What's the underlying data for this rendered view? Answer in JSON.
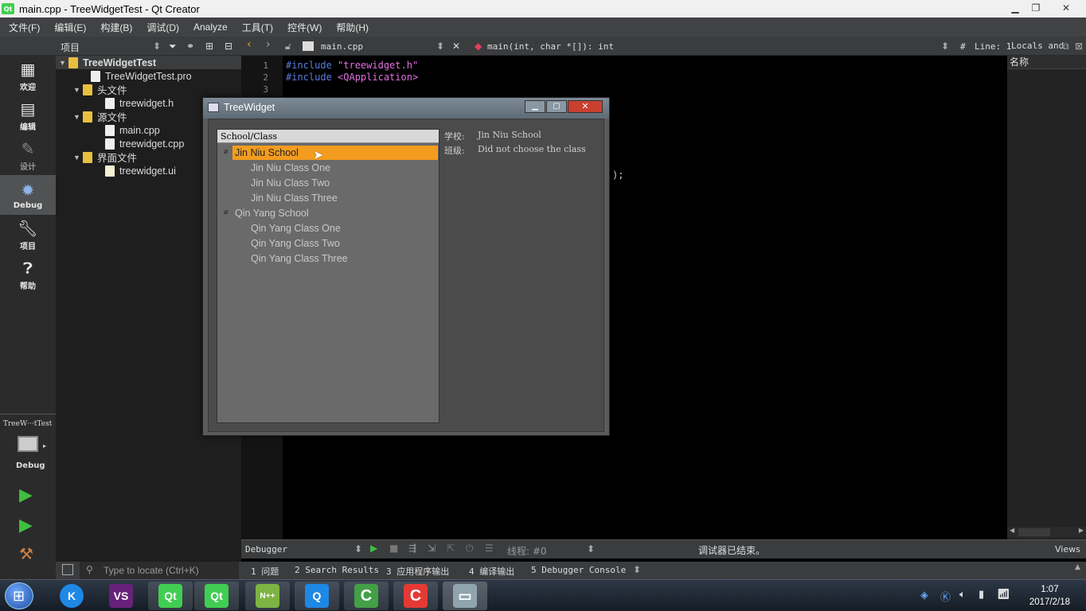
{
  "window": {
    "title": "main.cpp - TreeWidgetTest - Qt Creator"
  },
  "menu": [
    "文件(F)",
    "编辑(E)",
    "构建(B)",
    "调试(D)",
    "Analyze",
    "工具(T)",
    "控件(W)",
    "帮助(H)"
  ],
  "toolbar": {
    "panel_label": "项目",
    "file_name": "main.cpp",
    "symbol": "main(int, char *[]): int",
    "hash": "#",
    "line_label": "Line: 1",
    "locals_label": "Locals and"
  },
  "modes": [
    {
      "label": "欢迎",
      "icon": "grid-icon"
    },
    {
      "label": "编辑",
      "icon": "document-icon"
    },
    {
      "label": "设计",
      "icon": "pencil-icon"
    },
    {
      "label": "Debug",
      "icon": "bug-icon"
    },
    {
      "label": "项目",
      "icon": "wrench-icon"
    },
    {
      "label": "帮助",
      "icon": "help-icon"
    }
  ],
  "run_target": {
    "project": "TreeW···tTest",
    "config": "Debug"
  },
  "project_tree": {
    "root": "TreeWidgetTest",
    "pro_file": "TreeWidgetTest.pro",
    "headers_label": "头文件",
    "header_file": "treewidget.h",
    "sources_label": "源文件",
    "source_files": [
      "main.cpp",
      "treewidget.cpp"
    ],
    "forms_label": "界面文件",
    "form_file": "treewidget.ui"
  },
  "editor": {
    "lines": [
      "1",
      "2",
      "3"
    ],
    "line1_kw": "#include",
    "line1_str": "\"treewidget.h\"",
    "line2_kw": "#include",
    "line2_str": "<QApplication>",
    "frag": ");"
  },
  "right_panel": {
    "header": "名称"
  },
  "debugger_bar": {
    "selector": "Debugger",
    "thread_label": "线程: #0",
    "status": "调试器已结束。",
    "views": "Views"
  },
  "bottom_bar": {
    "locator_placeholder": "Type to locate (Ctrl+K)",
    "tabs": [
      "1  问题",
      "2  Search Results",
      "3  应用程序输出",
      "4  编译输出",
      "5  Debugger Console"
    ]
  },
  "dialog": {
    "title": "TreeWidget",
    "tree_header": "School/Class",
    "schools": [
      {
        "name": "Jin Niu School",
        "classes": [
          "Jin Niu Class One",
          "Jin Niu Class Two",
          "Jin Niu Class Three"
        ]
      },
      {
        "name": "Qin Yang School",
        "classes": [
          "Qin Yang Class One",
          "Qin Yang Class Two",
          "Qin Yang Class Three"
        ]
      }
    ],
    "school_label": "学校:",
    "school_value": "Jin Niu School",
    "class_label": "班级:",
    "class_value": "Did not choose the class"
  },
  "taskbar": {
    "apps": [
      {
        "icon": "k-icon",
        "glyph": "K",
        "color": "#1e88e5"
      },
      {
        "icon": "visual-studio-icon",
        "glyph": "VS",
        "color": "#68217a"
      },
      {
        "icon": "qt-icon",
        "glyph": "Qt",
        "color": "#41cd52"
      },
      {
        "icon": "qt-icon",
        "glyph": "Qt",
        "color": "#41cd52"
      },
      {
        "icon": "notepad-plus-icon",
        "glyph": "N++",
        "color": "#7cb342"
      },
      {
        "icon": "tencent-icon",
        "glyph": "Q",
        "color": "#1e88e5"
      },
      {
        "icon": "camtasia-c-icon",
        "glyph": "C",
        "color": "#43a047"
      },
      {
        "icon": "camtasia-red-icon",
        "glyph": "C",
        "color": "#e53935"
      },
      {
        "icon": "window-app-icon",
        "glyph": "▭",
        "color": "#90a4ae"
      }
    ],
    "time": "1:07",
    "date": "2017/2/18"
  }
}
